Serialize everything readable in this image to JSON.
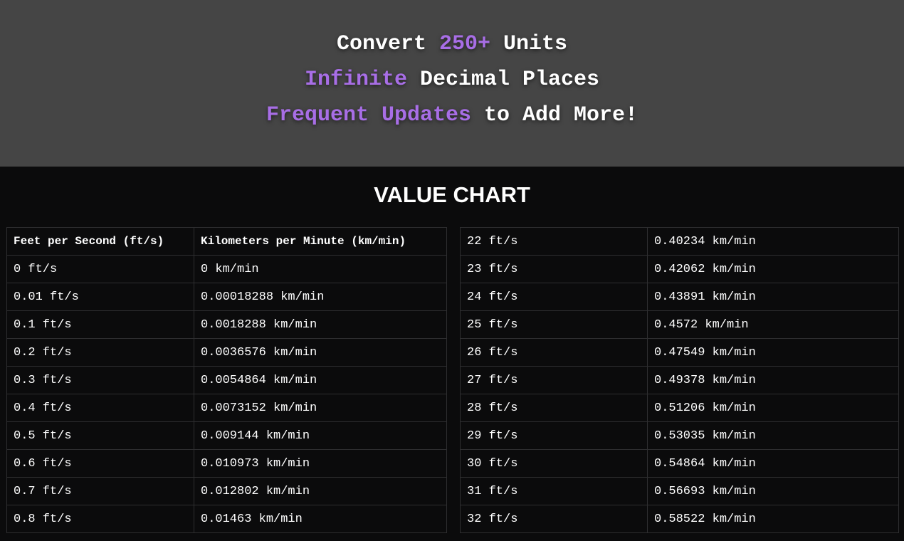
{
  "hero": {
    "line1": {
      "a": "Convert ",
      "highlight": "250+",
      "b": " Units"
    },
    "line2": {
      "highlight": "Infinite",
      "b": " Decimal Places"
    },
    "line3": {
      "highlight": "Frequent Updates",
      "b": " to Add More!"
    },
    "accent_color": "#a86ee6"
  },
  "chart": {
    "title": "VALUE CHART",
    "headers": [
      "Feet per Second (ft/s)",
      "Kilometers per Minute (km/min)"
    ],
    "left_rows": [
      [
        "0 ft/s",
        "0 km/min"
      ],
      [
        "0.01 ft/s",
        "0.00018288 km/min"
      ],
      [
        "0.1 ft/s",
        "0.0018288 km/min"
      ],
      [
        "0.2 ft/s",
        "0.0036576 km/min"
      ],
      [
        "0.3 ft/s",
        "0.0054864 km/min"
      ],
      [
        "0.4 ft/s",
        "0.0073152 km/min"
      ],
      [
        "0.5 ft/s",
        "0.009144 km/min"
      ],
      [
        "0.6 ft/s",
        "0.010973 km/min"
      ],
      [
        "0.7 ft/s",
        "0.012802 km/min"
      ],
      [
        "0.8 ft/s",
        "0.01463 km/min"
      ]
    ],
    "right_rows": [
      [
        "22 ft/s",
        "0.40234 km/min"
      ],
      [
        "23 ft/s",
        "0.42062 km/min"
      ],
      [
        "24 ft/s",
        "0.43891 km/min"
      ],
      [
        "25 ft/s",
        "0.4572 km/min"
      ],
      [
        "26 ft/s",
        "0.47549 km/min"
      ],
      [
        "27 ft/s",
        "0.49378 km/min"
      ],
      [
        "28 ft/s",
        "0.51206 km/min"
      ],
      [
        "29 ft/s",
        "0.53035 km/min"
      ],
      [
        "30 ft/s",
        "0.54864 km/min"
      ],
      [
        "31 ft/s",
        "0.56693 km/min"
      ],
      [
        "32 ft/s",
        "0.58522 km/min"
      ]
    ]
  }
}
